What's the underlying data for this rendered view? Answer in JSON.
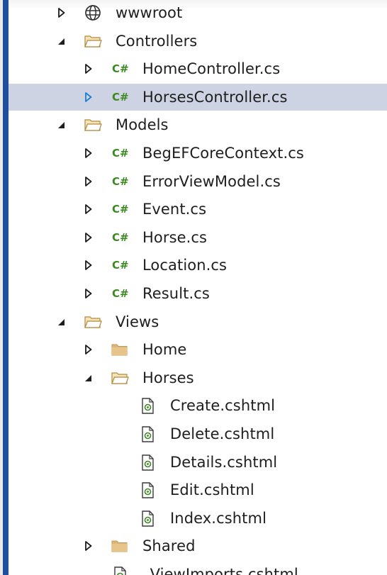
{
  "tree": {
    "items": [
      {
        "label": "wwwroot",
        "icon": "globe-icon",
        "expander": "collapsed",
        "depth": 1,
        "selected": false
      },
      {
        "label": "Controllers",
        "icon": "folder-open-icon",
        "expander": "expanded",
        "depth": 1,
        "selected": false
      },
      {
        "label": "HomeController.cs",
        "icon": "csharp-file-icon",
        "expander": "collapsed",
        "depth": 2,
        "selected": false
      },
      {
        "label": "HorsesController.cs",
        "icon": "csharp-file-icon",
        "expander": "collapsed",
        "depth": 2,
        "selected": true
      },
      {
        "label": "Models",
        "icon": "folder-open-icon",
        "expander": "expanded",
        "depth": 1,
        "selected": false
      },
      {
        "label": "BegEFCoreContext.cs",
        "icon": "csharp-file-icon",
        "expander": "collapsed",
        "depth": 2,
        "selected": false
      },
      {
        "label": "ErrorViewModel.cs",
        "icon": "csharp-file-icon",
        "expander": "collapsed",
        "depth": 2,
        "selected": false
      },
      {
        "label": "Event.cs",
        "icon": "csharp-file-icon",
        "expander": "collapsed",
        "depth": 2,
        "selected": false
      },
      {
        "label": "Horse.cs",
        "icon": "csharp-file-icon",
        "expander": "collapsed",
        "depth": 2,
        "selected": false
      },
      {
        "label": "Location.cs",
        "icon": "csharp-file-icon",
        "expander": "collapsed",
        "depth": 2,
        "selected": false
      },
      {
        "label": "Result.cs",
        "icon": "csharp-file-icon",
        "expander": "collapsed",
        "depth": 2,
        "selected": false
      },
      {
        "label": "Views",
        "icon": "folder-open-icon",
        "expander": "expanded",
        "depth": 1,
        "selected": false
      },
      {
        "label": "Home",
        "icon": "folder-closed-icon",
        "expander": "collapsed",
        "depth": 2,
        "selected": false
      },
      {
        "label": "Horses",
        "icon": "folder-open-icon",
        "expander": "expanded",
        "depth": 2,
        "selected": false
      },
      {
        "label": "Create.cshtml",
        "icon": "razor-file-icon",
        "expander": "none",
        "depth": 3,
        "selected": false
      },
      {
        "label": "Delete.cshtml",
        "icon": "razor-file-icon",
        "expander": "none",
        "depth": 3,
        "selected": false
      },
      {
        "label": "Details.cshtml",
        "icon": "razor-file-icon",
        "expander": "none",
        "depth": 3,
        "selected": false
      },
      {
        "label": "Edit.cshtml",
        "icon": "razor-file-icon",
        "expander": "none",
        "depth": 3,
        "selected": false
      },
      {
        "label": "Index.cshtml",
        "icon": "razor-file-icon",
        "expander": "none",
        "depth": 3,
        "selected": false
      },
      {
        "label": "Shared",
        "icon": "folder-closed-icon",
        "expander": "collapsed",
        "depth": 2,
        "selected": false
      },
      {
        "label": "_ViewImports.cshtml",
        "icon": "razor-file-icon",
        "expander": "none",
        "depth": 2,
        "selected": false
      }
    ]
  },
  "colors": {
    "selection_background": "#cdd3e2",
    "selected_expander": "#1a7fd4",
    "expander": "#1e1e1e",
    "csharp_icon": "#3b8a21",
    "folder_fill": "#dcb67a",
    "accent_bar": "#1f4e9c"
  },
  "icon_glyphs": {
    "csharp-file-icon": "C#"
  }
}
